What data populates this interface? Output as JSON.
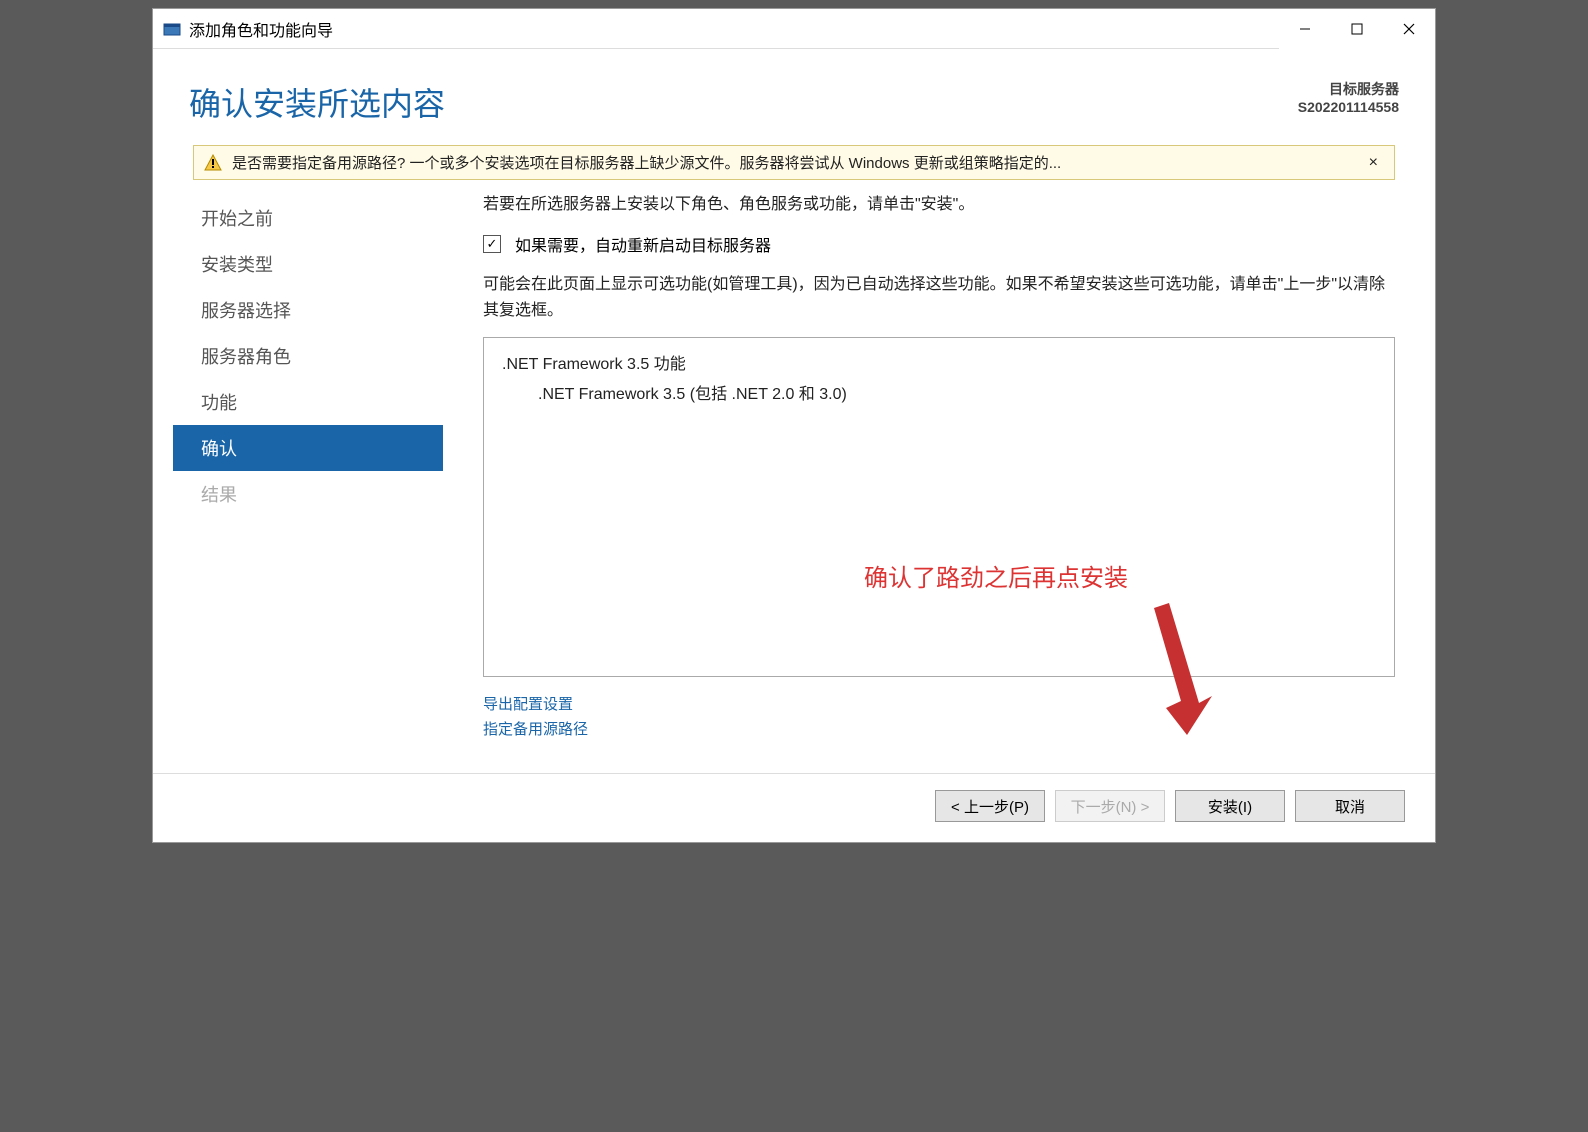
{
  "window": {
    "title": "添加角色和功能向导"
  },
  "header": {
    "title": "确认安装所选内容",
    "target_label": "目标服务器",
    "target_value": "S202201114558"
  },
  "warning": {
    "text": "是否需要指定备用源路径? 一个或多个安装选项在目标服务器上缺少源文件。服务器将尝试从 Windows 更新或组策略指定的..."
  },
  "sidebar": {
    "items": [
      {
        "label": "开始之前",
        "state": "normal"
      },
      {
        "label": "安装类型",
        "state": "normal"
      },
      {
        "label": "服务器选择",
        "state": "normal"
      },
      {
        "label": "服务器角色",
        "state": "normal"
      },
      {
        "label": "功能",
        "state": "normal"
      },
      {
        "label": "确认",
        "state": "active"
      },
      {
        "label": "结果",
        "state": "disabled"
      }
    ]
  },
  "main": {
    "instruction": "若要在所选服务器上安装以下角色、角色服务或功能，请单击\"安装\"。",
    "checkbox_label": "如果需要，自动重新启动目标服务器",
    "checkbox_checked": true,
    "note": "可能会在此页面上显示可选功能(如管理工具)，因为已自动选择这些功能。如果不希望安装这些可选功能，请单击\"上一步\"以清除其复选框。",
    "features": {
      "parent": ".NET Framework 3.5 功能",
      "child": ".NET Framework 3.5 (包括 .NET 2.0 和 3.0)"
    },
    "links": {
      "export": "导出配置设置",
      "alt_source": "指定备用源路径"
    }
  },
  "footer": {
    "prev": "< 上一步(P)",
    "next": "下一步(N) >",
    "install": "安装(I)",
    "cancel": "取消"
  },
  "annotation": {
    "text": "确认了路劲之后再点安装"
  }
}
